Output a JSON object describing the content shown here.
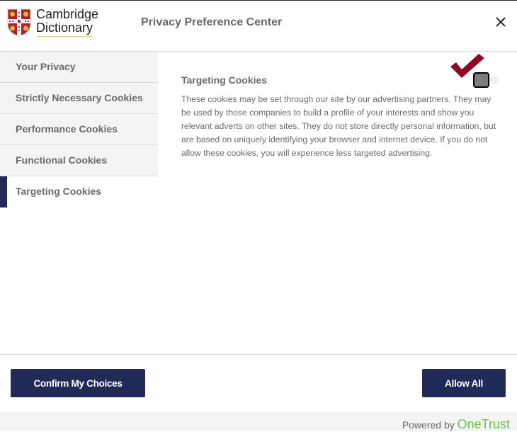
{
  "header": {
    "logo": {
      "line1": "Cambridge",
      "line2": "Dictionary"
    },
    "title": "Privacy Preference Center",
    "close_icon": "close-icon"
  },
  "sidebar": {
    "items": [
      {
        "label": "Your Privacy",
        "active": false
      },
      {
        "label": "Strictly Necessary Cookies",
        "active": false
      },
      {
        "label": "Performance Cookies",
        "active": false
      },
      {
        "label": "Functional Cookies",
        "active": false
      },
      {
        "label": "Targeting Cookies",
        "active": true
      }
    ]
  },
  "content": {
    "heading": "Targeting Cookies",
    "description": "These cookies may be set through our site by our advertising partners. They may be used by those companies to build a profile of your interests and show you relevant adverts on other sites. They do not store directly personal information, but are based on uniquely identifying your browser and internet device. If you do not allow these cookies, you will experience less targeted advertising.",
    "toggle": {
      "state": "off",
      "focused": true
    }
  },
  "footer": {
    "confirm_label": "Confirm My Choices",
    "allow_all_label": "Allow All",
    "powered_by": "Powered by",
    "brand": "OneTrust"
  },
  "colors": {
    "primary": "#1f2a56",
    "text": "#696969",
    "brand_green": "#6cc04a",
    "checkmark": "#8b0a25"
  }
}
